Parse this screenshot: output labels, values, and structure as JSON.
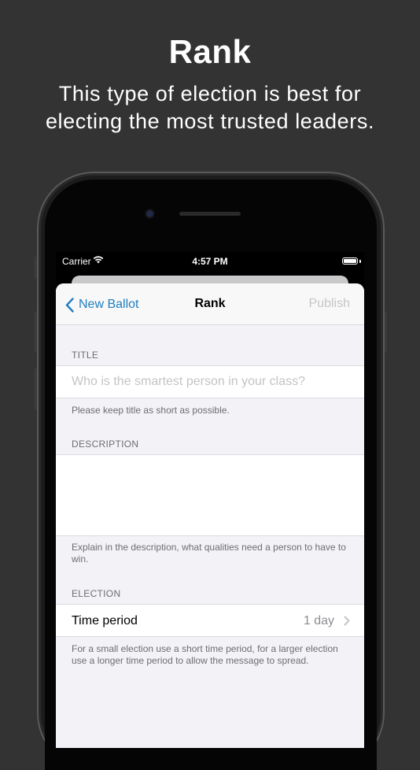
{
  "promo": {
    "title": "Rank",
    "subtitle": "This type of election is best for electing the most trusted leaders."
  },
  "status_bar": {
    "carrier": "Carrier",
    "time": "4:57 PM"
  },
  "nav": {
    "back_label": "New Ballot",
    "title": "Rank",
    "publish_label": "Publish"
  },
  "title_section": {
    "header": "TITLE",
    "placeholder": "Who is the smartest person in your class?",
    "footer": "Please keep title as short as possible."
  },
  "description_section": {
    "header": "DESCRIPTION",
    "footer": "Explain in the description, what qualities need a person to have to win."
  },
  "election_section": {
    "header": "ELECTION",
    "time_period_label": "Time period",
    "time_period_value": "1 day",
    "footer": "For a small election use a short time period, for a larger election use a longer time period to allow the message to spread."
  },
  "colors": {
    "accent": "#1f7fbf",
    "background": "#333333",
    "grouped_background": "#f2f2f7"
  }
}
